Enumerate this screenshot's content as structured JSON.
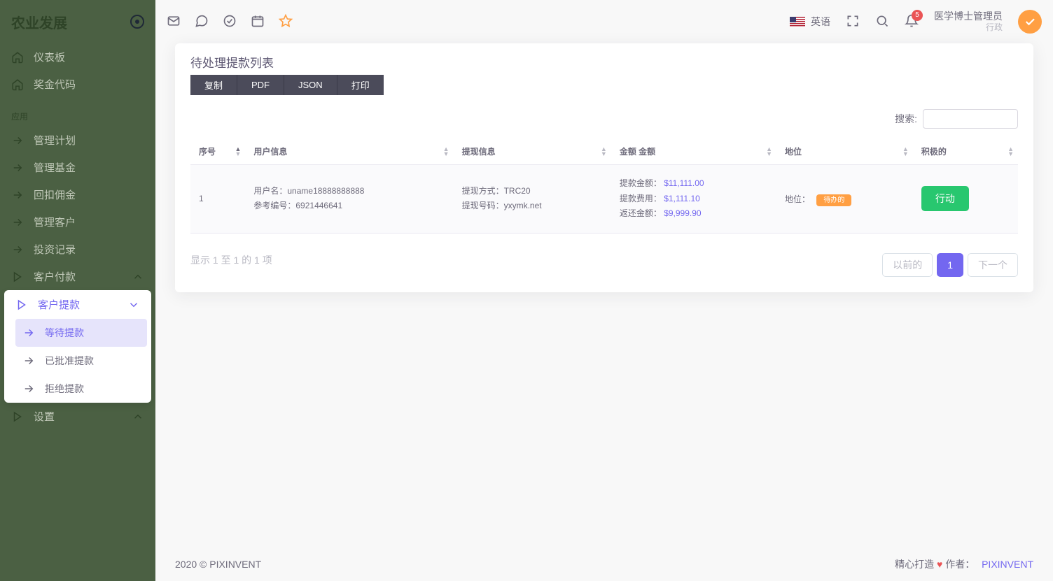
{
  "brand": "农业发展",
  "sidebar": {
    "dashboard": "仪表板",
    "bonus": "奖金代码",
    "section": "应用",
    "plan": "管理计划",
    "fund": "管理基金",
    "rebate": "回扣佣金",
    "customers": "管理客户",
    "investment": "投资记录",
    "payment": "客户付款",
    "withdrawal": "客户提款",
    "settings": "设置",
    "sub": {
      "pending": "等待提款",
      "approved": "已批准提款",
      "rejected": "拒绝提款"
    }
  },
  "header": {
    "lang": "英语",
    "notif_count": "5",
    "user_name": "医学博士管理员",
    "user_role": "行政"
  },
  "card": {
    "title": "待处理提款列表",
    "buttons": {
      "copy": "复制",
      "pdf": "PDF",
      "json": "JSON",
      "print": "打印"
    },
    "search_label": "搜索:"
  },
  "columns": {
    "sn": "序号",
    "user": "用户信息",
    "withdraw": "提现信息",
    "amount": "金额 金额",
    "status": "地位",
    "action": "积极的"
  },
  "row": {
    "sn": "1",
    "user_label": "用户名：",
    "user_value": "uname18888888888",
    "ref_label": "参考编号：",
    "ref_value": "6921446641",
    "method_label": "提现方式：",
    "method_value": "TRC20",
    "code_label": "提现号码：",
    "code_value": "yxymk.net",
    "amt_label": "提款金额：",
    "amt_value": "$11,111.00",
    "fee_label": "提款费用：",
    "fee_value": "$1,111.10",
    "return_label": "返还金额：",
    "return_value": "$9,999.90",
    "status_label": "地位：",
    "status_badge": "待办的",
    "action_btn": "行动"
  },
  "info": "显示 1 至 1 的 1 项",
  "pager": {
    "prev": "以前的",
    "p1": "1",
    "next": "下一个"
  },
  "footer": {
    "left": "2020 © PIXINVENT",
    "made": "精心打造",
    "author_label": "作者：",
    "author": "PIXINVENT"
  }
}
